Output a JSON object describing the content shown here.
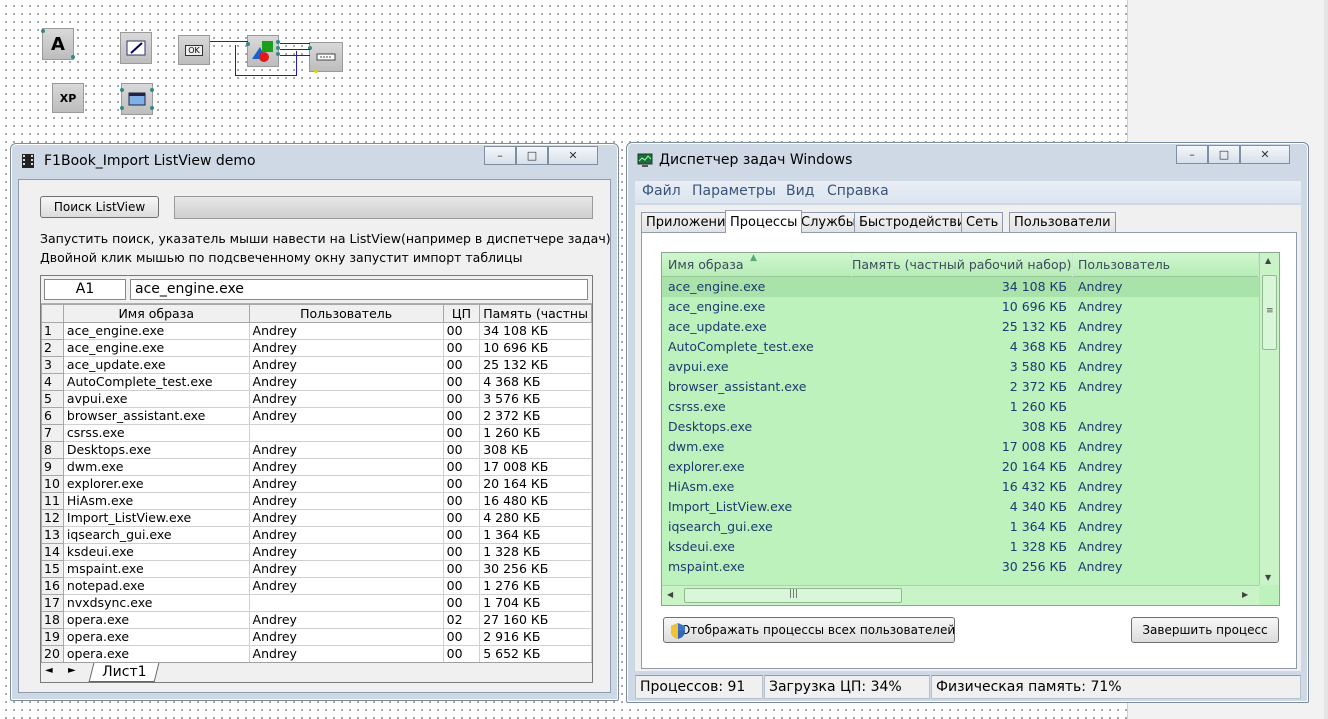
{
  "left_window": {
    "title": "F1Book_Import ListView demo",
    "search_button": "Поиск ListView",
    "hint_line1": "Запустить поиск, указатель мыши навести на ListView(например в диспетчере задач)",
    "hint_line2": "Двойной клик мышью по подсвеченному окну запустит импорт таблицы",
    "cell_ref": "A1",
    "cell_value": "ace_engine.exe",
    "columns": [
      "Имя образа",
      "Пользователь",
      "ЦП",
      "Память (частны"
    ],
    "rows": [
      [
        "1",
        "ace_engine.exe",
        "Andrey",
        "00",
        "34 108 КБ"
      ],
      [
        "2",
        "ace_engine.exe",
        "Andrey",
        "00",
        "10 696 КБ"
      ],
      [
        "3",
        "ace_update.exe",
        "Andrey",
        "00",
        "25 132 КБ"
      ],
      [
        "4",
        "AutoComplete_test.exe",
        "Andrey",
        "00",
        "4 368 КБ"
      ],
      [
        "5",
        "avpui.exe",
        "Andrey",
        "00",
        "3 576 КБ"
      ],
      [
        "6",
        "browser_assistant.exe",
        "Andrey",
        "00",
        "2 372 КБ"
      ],
      [
        "7",
        "csrss.exe",
        "",
        "00",
        "1 260 КБ"
      ],
      [
        "8",
        "Desktops.exe",
        "Andrey",
        "00",
        "308 КБ"
      ],
      [
        "9",
        "dwm.exe",
        "Andrey",
        "00",
        "17 008 КБ"
      ],
      [
        "10",
        "explorer.exe",
        "Andrey",
        "00",
        "20 164 КБ"
      ],
      [
        "11",
        "HiAsm.exe",
        "Andrey",
        "00",
        "16 480 КБ"
      ],
      [
        "12",
        "Import_ListView.exe",
        "Andrey",
        "00",
        "4 280 КБ"
      ],
      [
        "13",
        "iqsearch_gui.exe",
        "Andrey",
        "00",
        "1 364 КБ"
      ],
      [
        "14",
        "ksdeui.exe",
        "Andrey",
        "00",
        "1 328 КБ"
      ],
      [
        "15",
        "mspaint.exe",
        "Andrey",
        "00",
        "30 256 КБ"
      ],
      [
        "16",
        "notepad.exe",
        "Andrey",
        "00",
        "1 276 КБ"
      ],
      [
        "17",
        "nvxdsync.exe",
        "",
        "00",
        "1 704 КБ"
      ],
      [
        "18",
        "opera.exe",
        "Andrey",
        "02",
        "27 160 КБ"
      ],
      [
        "19",
        "opera.exe",
        "Andrey",
        "00",
        "2 916 КБ"
      ],
      [
        "20",
        "opera.exe",
        "Andrey",
        "00",
        "5 652 КБ"
      ]
    ],
    "sheet_tab": "Лист1",
    "nav_prev": "◄",
    "nav_next": "►"
  },
  "task_manager": {
    "title": "Диспетчер задач Windows",
    "menu": [
      "Файл",
      "Параметры",
      "Вид",
      "Справка"
    ],
    "tabs": [
      "Приложения",
      "Процессы",
      "Службы",
      "Быстродействие",
      "Сеть",
      "Пользователи"
    ],
    "active_tab": 1,
    "columns": [
      "Имя образа",
      "Память (частный рабочий набор)",
      "Пользователь"
    ],
    "rows": [
      [
        "ace_engine.exe",
        "34 108 КБ",
        "Andrey"
      ],
      [
        "ace_engine.exe",
        "10 696 КБ",
        "Andrey"
      ],
      [
        "ace_update.exe",
        "25 132 КБ",
        "Andrey"
      ],
      [
        "AutoComplete_test.exe",
        "4 368 КБ",
        "Andrey"
      ],
      [
        "avpui.exe",
        "3 580 КБ",
        "Andrey"
      ],
      [
        "browser_assistant.exe",
        "2 372 КБ",
        "Andrey"
      ],
      [
        "csrss.exe",
        "1 260 КБ",
        ""
      ],
      [
        "Desktops.exe",
        "308 КБ",
        "Andrey"
      ],
      [
        "dwm.exe",
        "17 008 КБ",
        "Andrey"
      ],
      [
        "explorer.exe",
        "20 164 КБ",
        "Andrey"
      ],
      [
        "HiAsm.exe",
        "16 432 КБ",
        "Andrey"
      ],
      [
        "Import_ListView.exe",
        "4 340 КБ",
        "Andrey"
      ],
      [
        "iqsearch_gui.exe",
        "1 364 КБ",
        "Andrey"
      ],
      [
        "ksdeui.exe",
        "1 328 КБ",
        "Andrey"
      ],
      [
        "mspaint.exe",
        "30 256 КБ",
        "Andrey"
      ]
    ],
    "show_all_button": "Отображать процессы всех пользователей",
    "end_process_button": "Завершить процесс",
    "status": {
      "processes": "Процессов: 91",
      "cpu": "Загрузка ЦП: 34%",
      "memory": "Физическая память: 71%"
    }
  },
  "palette": {
    "label_a": "A",
    "label_ok": "OK",
    "label_xp": "XP"
  },
  "colors": {
    "listview_bg": "#bdf2bd",
    "listview_text": "#1e3a6e",
    "window_frame": "#cfd9e5"
  }
}
